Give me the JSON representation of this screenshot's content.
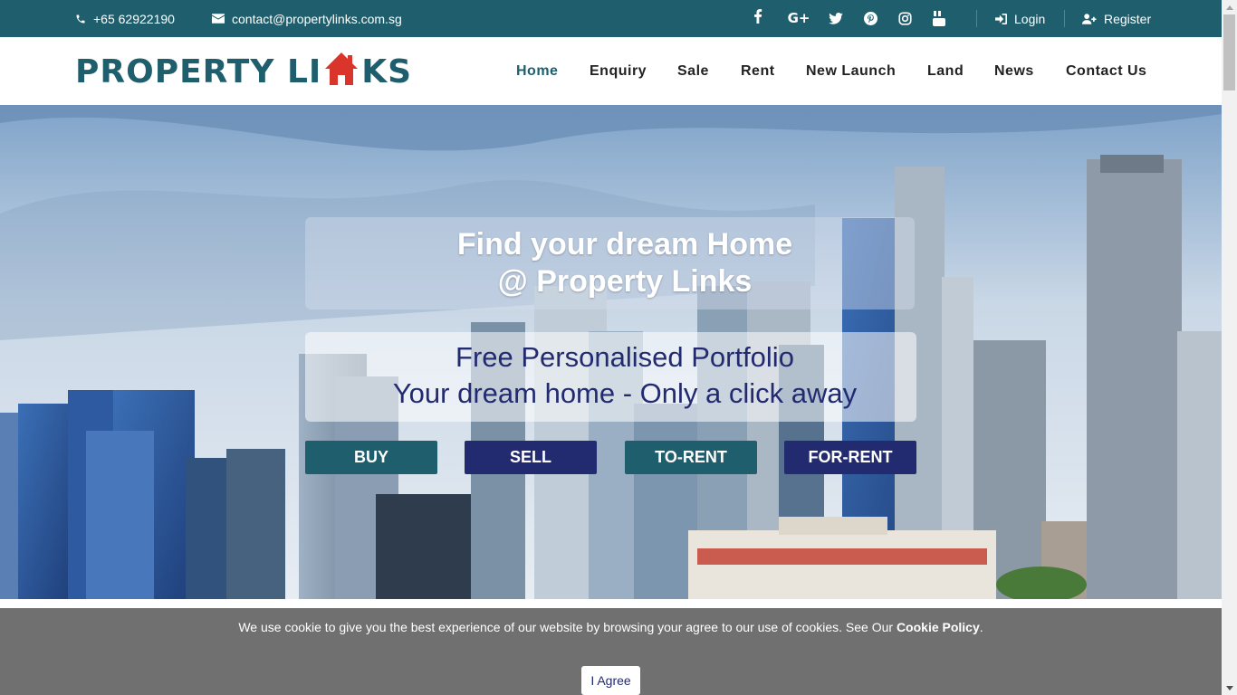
{
  "topbar": {
    "phone": "+65 62922190",
    "email": "contact@propertylinks.com.sg",
    "social": [
      "facebook-icon",
      "google-plus-icon",
      "twitter-icon",
      "pinterest-icon",
      "instagram-icon",
      "youtube-icon"
    ],
    "login_label": "Login",
    "register_label": "Register"
  },
  "brand": {
    "logo_left": "PROPERTY LI",
    "logo_right": "KS",
    "colors": {
      "teal": "#1f5f6d",
      "navy": "#232b70",
      "accent_red": "#d9352b"
    }
  },
  "nav": {
    "items": [
      "Home",
      "Enquiry",
      "Sale",
      "Rent",
      "New Launch",
      "Land",
      "News",
      "Contact Us"
    ],
    "active": "Home"
  },
  "hero": {
    "title_line1": "Find your dream Home",
    "title_line2": "@ Property Links",
    "subtitle_line1": "Free Personalised Portfolio",
    "subtitle_line2": "Your dream home - Only a click away",
    "buttons": [
      "BUY",
      "SELL",
      "TO-RENT",
      "FOR-RENT"
    ]
  },
  "cookie": {
    "message": "We use cookie to give you the best experience of our website by browsing your agree to our use of cookies. See Our ",
    "policy_link": "Cookie Policy",
    "period": ".",
    "agree_label": "I Agree"
  }
}
